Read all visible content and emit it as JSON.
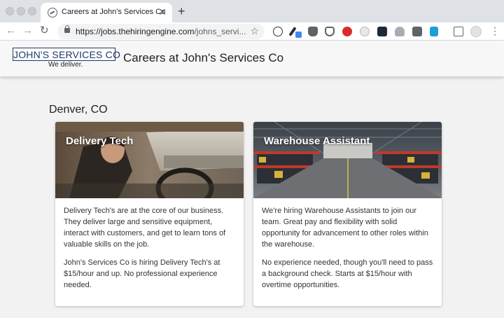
{
  "browser": {
    "tab_title": "Careers at John's Services Co",
    "url_host": "https://jobs.thehiringengine.com",
    "url_path": "/johns_servi...",
    "new_tab_symbol": "+",
    "tab_close_symbol": "✕"
  },
  "header": {
    "logo_text": "JOHN'S SERVICES CO",
    "logo_tagline": "We deliver.",
    "title": "Careers at John's Services Co"
  },
  "location": "Denver, CO",
  "jobs": [
    {
      "title": "Delivery Tech",
      "paragraphs": [
        "Delivery Tech's are at the core of our business. They deliver large and sensitive equipment, interact with customers, and get to learn tons of valuable skills on the job.",
        "John's Services Co is hiring Delivery Tech's at $15/hour and up. No professional experience needed."
      ]
    },
    {
      "title": "Warehouse Assistant",
      "paragraphs": [
        "We're hiring Warehouse Assistants to join our team. Great pay and flexibility with solid opportunity for advancement to other roles within the warehouse.",
        "No experience needed, though you'll need to pass a background check. Starts at $15/hour with overtime opportunities."
      ]
    }
  ],
  "colors": {
    "brand_navy": "#1f3a66",
    "page_bg": "#f2f2f2"
  }
}
